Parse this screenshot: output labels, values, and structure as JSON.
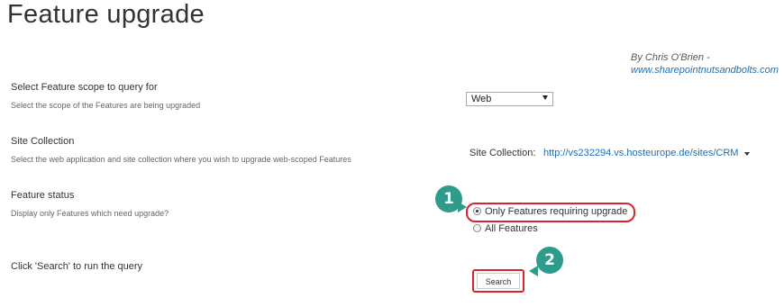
{
  "page": {
    "title": "Feature upgrade"
  },
  "credit": {
    "line1": "By Chris O'Brien -",
    "link": "www.sharepointnutsandbolts.com"
  },
  "sections": {
    "scope": {
      "title": "Select Feature scope to query for",
      "description": "Select the scope of the Features are being upgraded",
      "selected": "Web"
    },
    "site_collection": {
      "title": "Site Collection",
      "description": "Select the web application and site collection where you wish to upgrade web-scoped Features",
      "label": "Site Collection:",
      "url": "http://vs232294.vs.hosteurope.de/sites/CRM"
    },
    "status": {
      "title": "Feature status",
      "description": "Display only Features which need upgrade?",
      "options": [
        "Only Features requiring upgrade",
        "All Features"
      ],
      "selected_index": 0
    },
    "search": {
      "title": "Click 'Search' to run the query",
      "button_label": "Search"
    }
  },
  "badges": [
    "1",
    "2"
  ],
  "colors": {
    "accent": "#2e9b8b",
    "highlight": "#d9232e",
    "link": "#1f6fb5"
  },
  "icons": {
    "select_arrow": "dropdown-arrow-icon",
    "caret": "chevron-down-icon"
  }
}
